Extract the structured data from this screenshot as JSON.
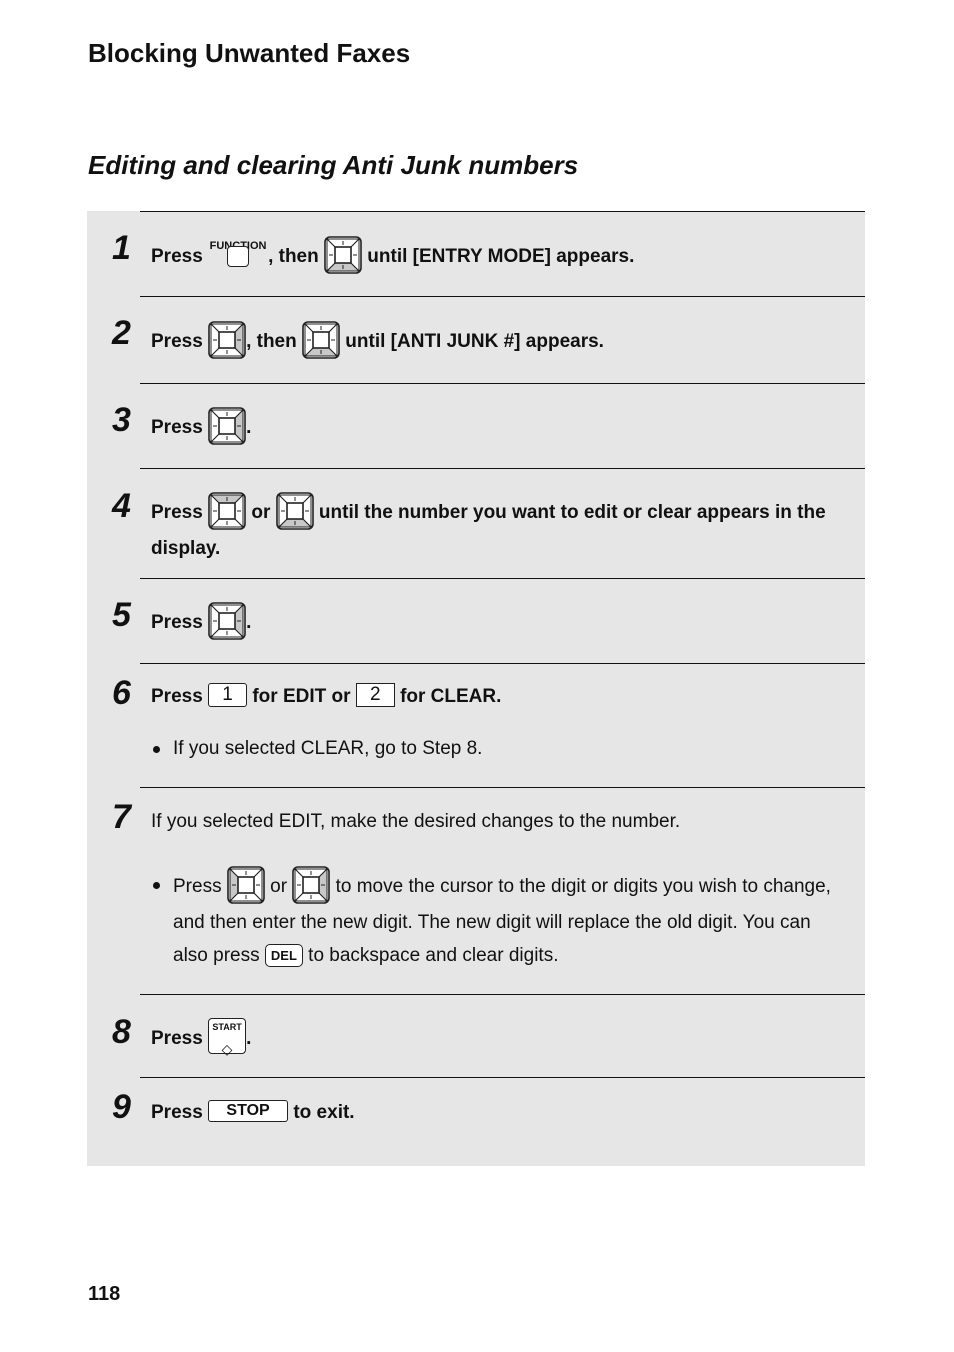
{
  "header": {
    "section_title": "Blocking Unwanted Faxes",
    "subsection_title": "Editing and clearing Anti Junk numbers"
  },
  "colors": {
    "panel_bg": "#e6e6e6",
    "key_highlight": "#c8c8c8",
    "text": "#111111"
  },
  "keys": {
    "function_label": "FUNCTION",
    "start_label": "START",
    "start_symbol": "◇",
    "stop_label": "STOP",
    "del_label": "DEL",
    "one_label": "1",
    "two_label": "2"
  },
  "steps": [
    {
      "number": "1",
      "press": "Press",
      "then": ", then",
      "tail": "until [ENTRY MODE] appears.",
      "icons": [
        "function-key",
        "arrow-key-down"
      ]
    },
    {
      "number": "2",
      "press": "Press",
      "then": ", then",
      "tail": "until [ANTI JUNK #] appears.",
      "icons": [
        "arrow-key-right",
        "arrow-key-down"
      ]
    },
    {
      "number": "3",
      "press": "Press",
      "tail": ".",
      "icons": [
        "arrow-key-right"
      ]
    },
    {
      "number": "4",
      "press": "Press",
      "or": "or",
      "tail": "until the number you want to edit or clear appears in the display.",
      "icons": [
        "arrow-key-up",
        "arrow-key-down"
      ]
    },
    {
      "number": "5",
      "press": "Press",
      "tail": ".",
      "icons": [
        "arrow-key-right"
      ]
    },
    {
      "number": "6",
      "press": "Press",
      "mid": "for EDIT or",
      "tail": "for CLEAR.",
      "bullet": "If you selected CLEAR, go to Step 8."
    },
    {
      "number": "7",
      "text": "If you selected EDIT, make the desired changes to the number.",
      "bullet_press": "Press",
      "bullet_or": "or",
      "bullet_mid": "to move the cursor to the digit or digits you wish to change, and then enter the new digit. The new digit will replace the old digit. You can also press",
      "bullet_tail": "to backspace and clear digits.",
      "icons": [
        "arrow-key-left",
        "arrow-key-right"
      ]
    },
    {
      "number": "8",
      "press": "Press",
      "tail": "."
    },
    {
      "number": "9",
      "press": "Press",
      "tail": "to exit."
    }
  ],
  "footer": {
    "page_number": "118"
  }
}
